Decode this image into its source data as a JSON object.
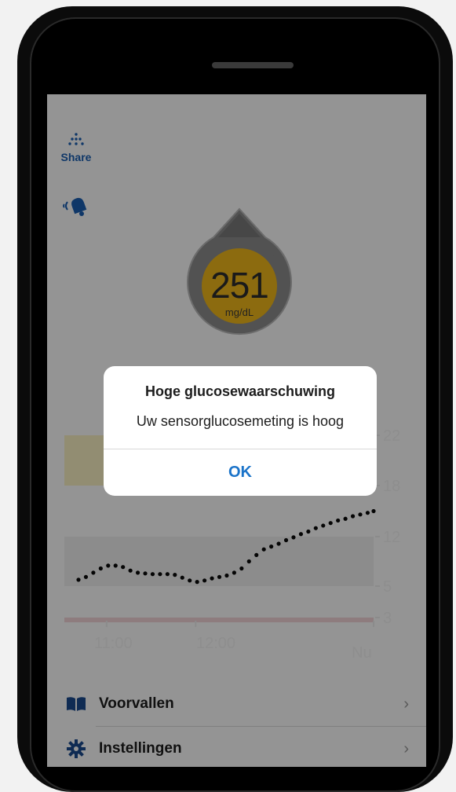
{
  "header": {
    "share_label": "Share",
    "share_icon": "share-dots-icon",
    "alarm_icon": "bell-alarm-icon"
  },
  "glucose": {
    "value": "251",
    "unit": "mg/dL",
    "trend_icon": "trend-arrow-up-icon",
    "color": "#f1b81b"
  },
  "chart_data": {
    "type": "scatter",
    "ylabel": "",
    "xlabel": "",
    "yticks": [
      "22",
      "18",
      "12",
      "5",
      "3"
    ],
    "xticks": [
      "11:00",
      "12:00",
      "Nu"
    ],
    "ylim": [
      2,
      23
    ],
    "bands": [
      {
        "name": "high",
        "from": 18,
        "to": 22,
        "color": "#fbf3c4"
      },
      {
        "name": "target",
        "from": 5,
        "to": 12,
        "color": "#f2f2f2"
      },
      {
        "name": "low",
        "from": 2,
        "to": 3,
        "color": "#f5d6da"
      }
    ],
    "series": [
      {
        "x": [
          "10:41",
          "10:46",
          "10:51",
          "10:56",
          "11:01",
          "11:06",
          "11:11",
          "11:16",
          "11:21",
          "11:26",
          "11:31",
          "11:36",
          "11:41",
          "11:46",
          "11:51",
          "11:56",
          "12:01",
          "12:06",
          "12:11",
          "12:16",
          "12:21",
          "12:26",
          "12:31",
          "12:36",
          "12:41",
          "12:46",
          "12:51",
          "12:56",
          "13:01",
          "13:06",
          "13:11",
          "13:16",
          "13:21",
          "13:26",
          "13:31",
          "13:36",
          "13:41",
          "13:46",
          "13:51",
          "13:56",
          "14:00"
        ],
        "values": [
          5.9,
          6.3,
          6.9,
          7.5,
          7.9,
          7.9,
          7.7,
          7.2,
          6.9,
          6.8,
          6.7,
          6.7,
          6.7,
          6.6,
          6.2,
          5.8,
          5.6,
          5.8,
          6.1,
          6.3,
          6.5,
          6.9,
          7.5,
          8.5,
          9.4,
          10.2,
          10.6,
          11.0,
          11.5,
          11.9,
          12.3,
          12.6,
          13.0,
          13.3,
          13.6,
          13.9,
          14.1,
          14.4,
          14.6,
          14.8,
          15.0
        ],
        "color": "#0a0a0a"
      }
    ]
  },
  "alert": {
    "title": "Hoge glucosewaarschuwing",
    "message": "Uw sensorglucosemeting is hoog",
    "ok_label": "OK"
  },
  "menu": {
    "items": [
      {
        "label": "Voorvallen",
        "icon": "book-icon"
      },
      {
        "label": "Instellingen",
        "icon": "gear-icon"
      }
    ]
  }
}
